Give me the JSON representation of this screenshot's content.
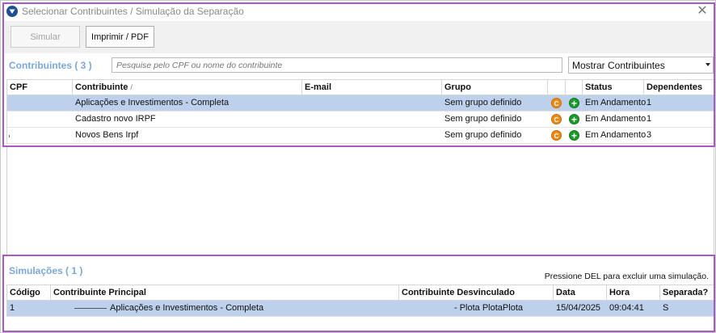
{
  "window": {
    "title": "Selecionar Contribuintes / Simulação da Separação",
    "close_symbol": "✕"
  },
  "toolbar": {
    "simular_label": "Simular",
    "imprimir_label": "Imprimir / PDF"
  },
  "contribuintes": {
    "title": "Contribuintes ( 3 )",
    "search_placeholder": "Pesquise pelo CPF ou nome do contribuinte",
    "filter_selected": "Mostrar Contribuintes",
    "columns": {
      "cpf": "CPF",
      "contribuinte": "Contribuinte",
      "email": "E-mail",
      "grupo": "Grupo",
      "status": "Status",
      "dependentes": "Dependentes"
    },
    "rows": [
      {
        "cpf": "",
        "contribuinte": "Aplicações e Investimentos - Completa",
        "email": "",
        "grupo": "Sem grupo definido",
        "badge": "C",
        "status": "Em Andamento",
        "dependentes": "1"
      },
      {
        "cpf": "",
        "contribuinte": "Cadastro novo IRPF",
        "email": "",
        "grupo": "Sem grupo definido",
        "badge": "C",
        "status": "Em Andamento",
        "dependentes": "1"
      },
      {
        "cpf": "",
        "contribuinte": "Novos Bens Irpf",
        "email": "",
        "grupo": "Sem grupo definido",
        "badge": "C",
        "status": "Em Andamento",
        "dependentes": "3"
      }
    ],
    "selected_row": 0
  },
  "simulacoes": {
    "title": "Simulações ( 1 )",
    "hint": "Pressione DEL para excluir uma simulação.",
    "columns": {
      "codigo": "Código",
      "principal": "Contribuinte Principal",
      "desvinculado": "Contribuinte Desvinculado",
      "data": "Data",
      "hora": "Hora",
      "separada": "Separada?"
    },
    "rows": [
      {
        "codigo": "1",
        "principal": "Aplicações e Investimentos - Completa",
        "desvinculado": "- Plota PlotaPlota",
        "data": "15/04/2025",
        "hora": "09:04:41",
        "separada": "S"
      }
    ]
  },
  "colors": {
    "highlight_frame": "#a65ac2",
    "section_title": "#7ba8d6",
    "selected_row": "#bdd0ec",
    "badge_c": "#ea8a17",
    "badge_plus": "#1c9a2a"
  },
  "icons": {
    "app": "shield-icon",
    "close": "close-icon",
    "badge": "c-badge-icon",
    "add": "plus-circle-icon",
    "dropdown": "caret-down-icon"
  }
}
